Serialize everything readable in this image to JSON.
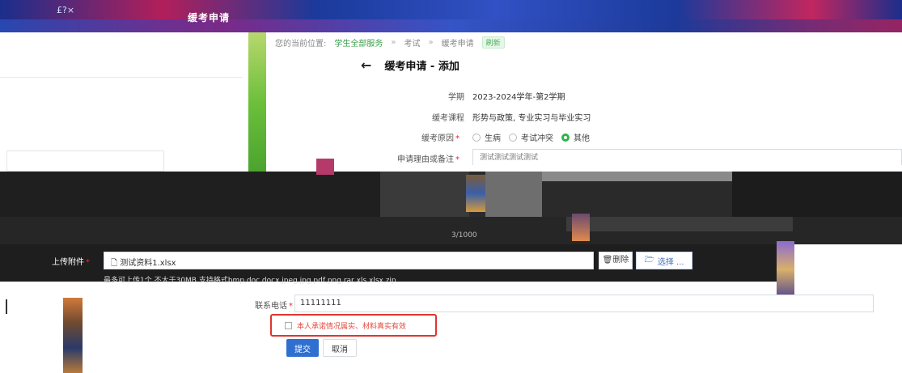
{
  "header": {
    "title": "缓考申请",
    "deco_text": "£?×"
  },
  "breadcrumb": {
    "prefix": "您的当前位置:",
    "items": [
      "学生全部服务",
      "考试",
      "缓考申请"
    ],
    "separator": "»",
    "refresh": "刷新"
  },
  "page": {
    "back_icon": "←",
    "title": "缓考申请 - 添加"
  },
  "form": {
    "term": {
      "label": "学期",
      "value": "2023-2024学年-第2学期"
    },
    "course": {
      "label": "缓考课程",
      "value": "形势与政策, 专业实习与毕业实习"
    },
    "reason": {
      "label": "缓考原因",
      "options": [
        "生病",
        "考试冲突",
        "其他"
      ],
      "selected": "其他"
    },
    "remark": {
      "label": "申请理由或备注",
      "value": "测试测试测试测试"
    },
    "code_text": "3/1000",
    "upload": {
      "label": "上传附件",
      "file_name": "测试资料1.xlsx",
      "remove_label": "删除",
      "choose_label": "选择 ...",
      "hint": "最多可上传1个,不大于30MB,支持格式bmp,doc,docx,jpeg,jpg,pdf,png,rar,xls,xlsx,zip"
    },
    "phone": {
      "label": "联系电话",
      "value": "11111111"
    },
    "commitment": "本人承诺情况属实、材料真实有效"
  },
  "actions": {
    "submit": "提交",
    "cancel": "取消"
  },
  "colors": {
    "primary": "#2f6fd0",
    "success": "#2fb44a",
    "danger": "#e0352f"
  }
}
